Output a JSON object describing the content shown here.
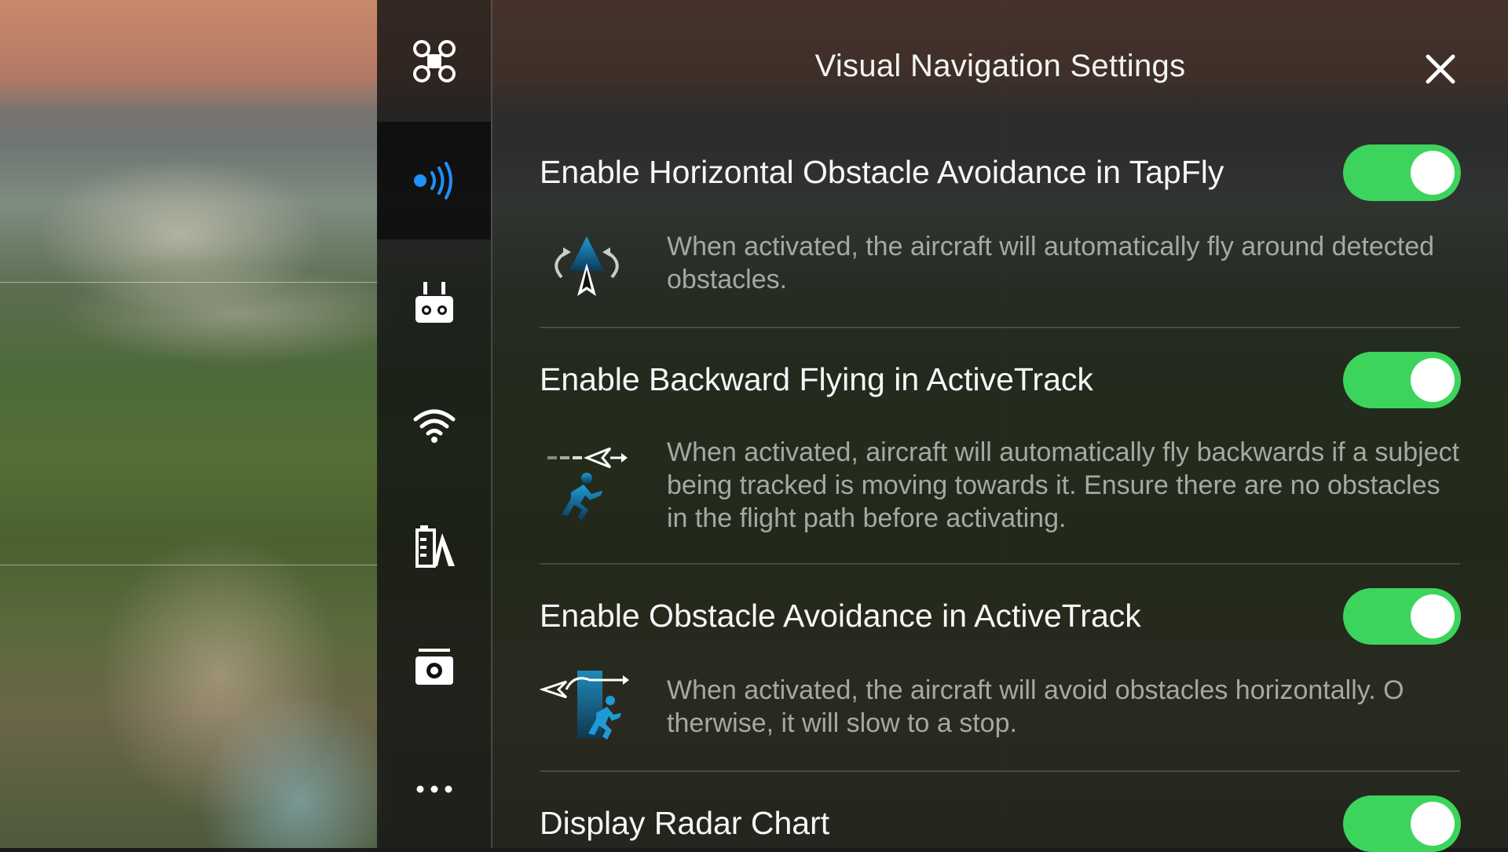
{
  "panel": {
    "title": "Visual Navigation Settings",
    "close_icon": "close-icon"
  },
  "sidebar": {
    "items": [
      {
        "icon": "aircraft-icon",
        "active": false
      },
      {
        "icon": "sensors-icon",
        "active": true
      },
      {
        "icon": "remote-controller-icon",
        "active": false
      },
      {
        "icon": "wifi-icon",
        "active": false
      },
      {
        "icon": "battery-icon",
        "active": false
      },
      {
        "icon": "camera-icon",
        "active": false
      },
      {
        "icon": "more-icon",
        "active": false
      }
    ]
  },
  "settings": [
    {
      "label": "Enable Horizontal Obstacle Avoidance in TapFly",
      "description": "When activated, the aircraft will automatically fly around detected obstacles.",
      "icon": "tapfly-avoidance-icon",
      "enabled": true
    },
    {
      "label": "Enable Backward Flying in ActiveTrack",
      "description": "When activated, aircraft will automatically fly backwards if a subject being tracked is moving towards it. Ensure there are no obstacles in the flight path before activating.",
      "icon": "backward-flying-icon",
      "enabled": true
    },
    {
      "label": "Enable Obstacle Avoidance in ActiveTrack",
      "description": "When activated, the aircraft will avoid obstacles horizontally. O therwise, it will slow to a stop.",
      "icon": "activetrack-avoidance-icon",
      "enabled": true
    },
    {
      "label": "Display Radar Chart",
      "enabled": true
    }
  ],
  "colors": {
    "toggle_on": "#3dd45d",
    "accent_blue": "#1e90ff",
    "description_text": "#a7a7a7"
  }
}
